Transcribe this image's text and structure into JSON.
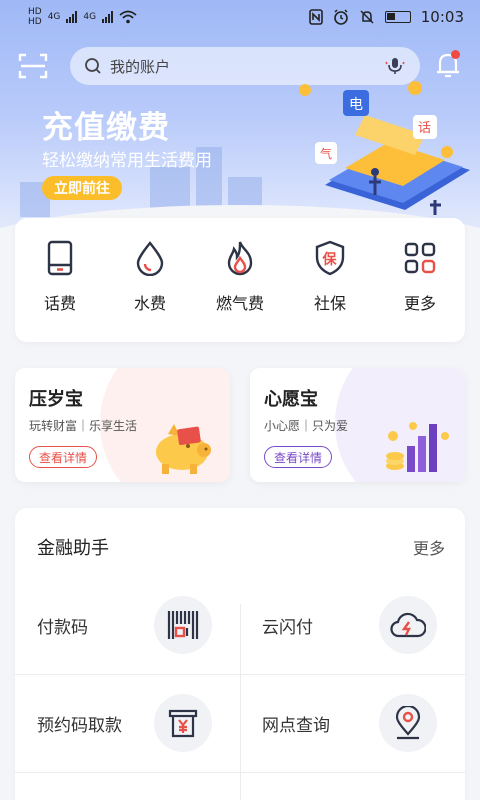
{
  "status": {
    "sim1": "HD",
    "sim2": "HD",
    "net1": "4G",
    "net2": "4G",
    "time": "10:03"
  },
  "search": {
    "placeholder": "我的账户"
  },
  "hero": {
    "title": "充值缴费",
    "subtitle": "轻松缴纳常用生活费用",
    "button": "立即前往"
  },
  "quick_menu": [
    {
      "label": "话费",
      "icon": "phone-icon"
    },
    {
      "label": "水费",
      "icon": "water-drop-icon"
    },
    {
      "label": "燃气费",
      "icon": "flame-icon"
    },
    {
      "label": "社保",
      "icon": "shield-icon"
    },
    {
      "label": "更多",
      "icon": "grid-icon"
    }
  ],
  "promos": [
    {
      "title": "压岁宝",
      "subtitle": "玩转财富｜乐享生活",
      "button": "查看详情",
      "color": "#e8504a"
    },
    {
      "title": "心愿宝",
      "subtitle": "小心愿｜只为爱",
      "button": "查看详情",
      "color": "#7a4bc8"
    }
  ],
  "finance": {
    "title": "金融助手",
    "more": "更多",
    "items": [
      {
        "label": "付款码",
        "icon": "barcode-icon"
      },
      {
        "label": "云闪付",
        "icon": "cloud-flash-icon"
      },
      {
        "label": "预约码取款",
        "icon": "cash-yuan-icon"
      },
      {
        "label": "网点查询",
        "icon": "location-pin-icon"
      }
    ]
  },
  "colors": {
    "accent_red": "#e8504a",
    "accent_purple": "#7a4bc8",
    "hero_button": "#fbbd2a"
  }
}
